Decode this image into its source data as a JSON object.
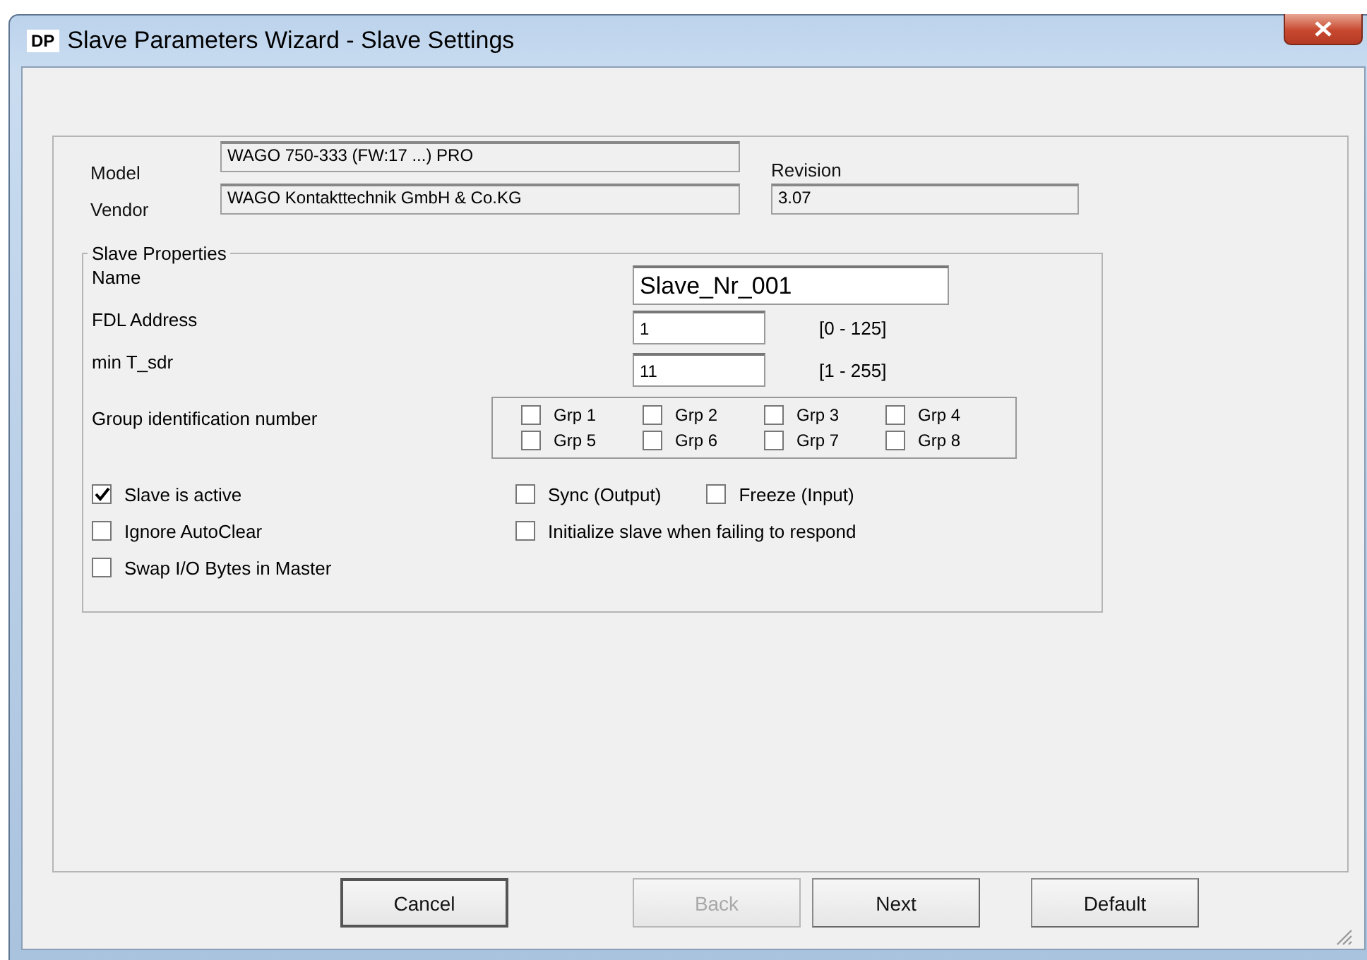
{
  "window": {
    "badge": "DP",
    "title": "Slave Parameters Wizard - Slave Settings"
  },
  "info": {
    "model_label": "Model",
    "model": "WAGO 750-333 (FW:17 ...) PRO",
    "vendor_label": "Vendor",
    "vendor": "WAGO Kontakttechnik GmbH & Co.KG",
    "revision_label": "Revision",
    "revision": "3.07"
  },
  "properties": {
    "title": "Slave Properties",
    "name": {
      "label": "Name",
      "value": "Slave_Nr_001"
    },
    "fdl_address": {
      "label": "FDL Address",
      "value": "1",
      "range": "[0 - 125]"
    },
    "min_tsdr": {
      "label": "min T_sdr",
      "value": "11",
      "range": "[1 - 255]"
    },
    "groups": {
      "label": "Group identification number",
      "items": [
        {
          "label": "Grp 1",
          "checked": false
        },
        {
          "label": "Grp 2",
          "checked": false
        },
        {
          "label": "Grp 3",
          "checked": false
        },
        {
          "label": "Grp 4",
          "checked": false
        },
        {
          "label": "Grp 5",
          "checked": false
        },
        {
          "label": "Grp 6",
          "checked": false
        },
        {
          "label": "Grp 7",
          "checked": false
        },
        {
          "label": "Grp 8",
          "checked": false
        }
      ]
    },
    "option_rows": [
      {
        "left": {
          "label": "Slave is active",
          "checked": true
        },
        "right": [
          {
            "label": "Sync (Output)",
            "checked": false
          },
          {
            "label": "Freeze (Input)",
            "checked": false
          }
        ]
      },
      {
        "left": {
          "label": "Ignore AutoClear",
          "checked": false
        },
        "right": [
          {
            "label": "Initialize slave when failing to respond",
            "checked": false
          }
        ]
      },
      {
        "left": {
          "label": "Swap I/O Bytes in Master",
          "checked": false
        },
        "right": []
      }
    ]
  },
  "buttons": [
    {
      "label": "Cancel",
      "disabled": false,
      "default": true
    },
    {
      "label": "Back",
      "disabled": true,
      "default": false
    },
    {
      "label": "Next",
      "disabled": false,
      "default": false
    },
    {
      "label": "Default",
      "disabled": false,
      "default": false
    }
  ]
}
